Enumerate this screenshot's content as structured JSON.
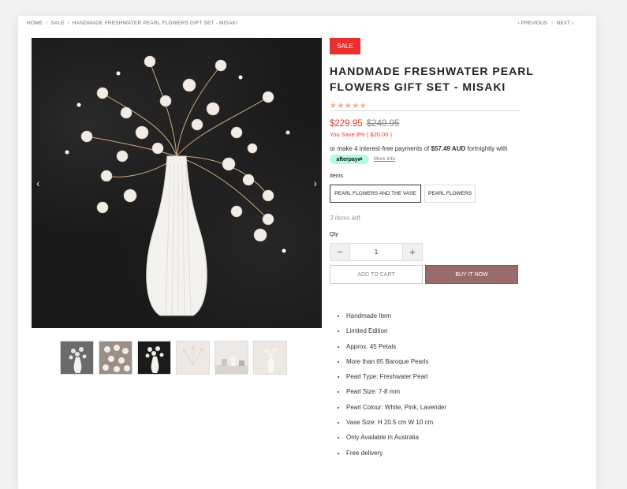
{
  "breadcrumb": {
    "home": "HOME",
    "sale": "SALE",
    "current": "HANDMADE FRESHWATER PEARL FLOWERS GIFT SET - MISAKI"
  },
  "nav": {
    "previous": "PREVIOUS",
    "next": "NEXT"
  },
  "product": {
    "badge": "SALE",
    "title": "HANDMADE FRESHWATER PEARL FLOWERS GIFT SET - MISAKI",
    "stars": "★★★★★",
    "rating_stars": 5,
    "price_now": "$229.95",
    "price_was": "$249.95",
    "save_text": "You Save 8% ( $20.00 )",
    "afterpay_prefix": "or make 4 interest-free payments of",
    "afterpay_amount": "$57.49 AUD",
    "afterpay_suffix": "fortnightly with",
    "afterpay_logo": "afterpay",
    "more_info": "More info",
    "items_label": "Items",
    "options": [
      "PEARL FLOWERS AND THE VASE",
      "PEARL FLOWERS"
    ],
    "selected_option": "PEARL FLOWERS AND THE VASE",
    "stock_text": "3 items left",
    "qty_label": "Qty",
    "qty_value": "1",
    "add_to_cart": "ADD TO CART",
    "buy_now": "BUY IT NOW",
    "features": [
      "Handmade Item",
      "Limited Edition",
      "Approx. 45 Petals",
      "More than 65 Baroque Pearls",
      "Pearl Type: Freshwater Pearl",
      "Pearl Size: 7-8 mm",
      "Pearl Colour: White, Pink, Lavender",
      "Vase Size: H 20.5 cm W 10 cm",
      "Only Available in Australia",
      "Free delivery"
    ]
  },
  "colors": {
    "sale": "#e8312e",
    "buy_now": "#9a6b6b",
    "stars": "#f3b08f",
    "afterpay": "#b2fce4"
  }
}
